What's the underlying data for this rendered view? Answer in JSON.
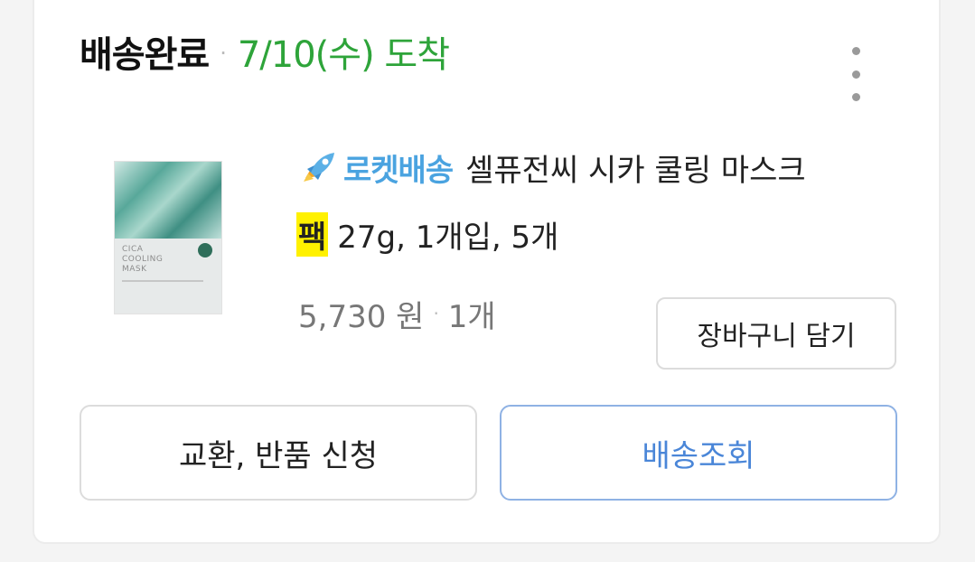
{
  "order": {
    "status": "배송완료",
    "separator": "·",
    "arrival": "7/10(수) 도착"
  },
  "product": {
    "delivery_badge": "로켓배송",
    "name_line1": "셀퓨전씨 시카 쿨링 마스크",
    "highlight": "팩",
    "name_line2_rest": "27g, 1개입, 5개",
    "price": "5,730 원",
    "separator": "·",
    "quantity": "1개",
    "image_text": {
      "product_name": "CICA\nCOOLING\nMASK"
    }
  },
  "buttons": {
    "add_to_cart": "장바구니 담기",
    "exchange_return": "교환, 반품 신청",
    "track_delivery": "배송조회"
  },
  "colors": {
    "arrival_green": "#2ea43a",
    "rocket_blue": "#4aa3e0",
    "track_blue": "#4a86d8",
    "highlight_yellow": "#fff100"
  },
  "icons": {
    "more": "more-vertical-icon",
    "rocket": "rocket-icon"
  }
}
